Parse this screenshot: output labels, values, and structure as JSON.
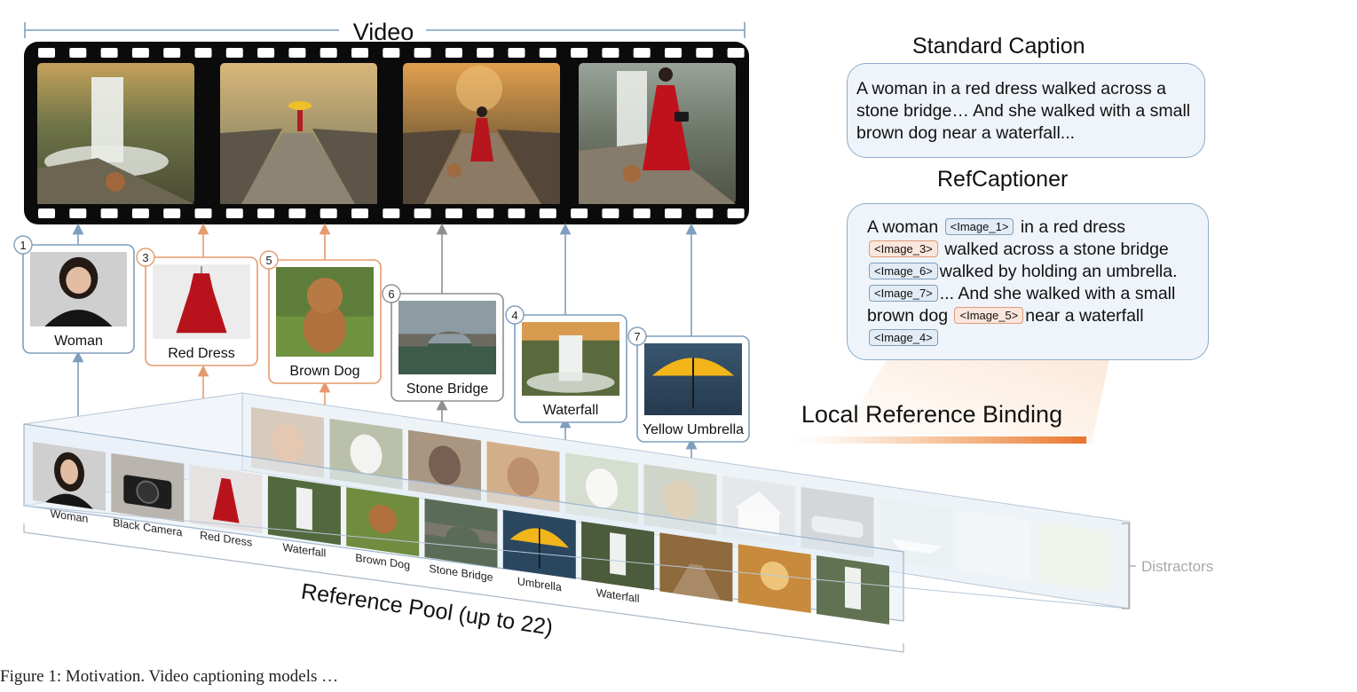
{
  "video": {
    "title": "Video",
    "frames": [
      "frame-waterfall-dog",
      "frame-umbrella-bridge",
      "frame-woman-dog-bridge",
      "frame-woman-camera-waterfall"
    ]
  },
  "references": [
    {
      "num": "1",
      "label": "Woman",
      "style": "blue",
      "icon": "woman-portrait"
    },
    {
      "num": "3",
      "label": "Red Dress",
      "style": "orange",
      "icon": "red-dress"
    },
    {
      "num": "5",
      "label": "Brown Dog",
      "style": "orange",
      "icon": "brown-dog"
    },
    {
      "num": "6",
      "label": "Stone Bridge",
      "style": "gray",
      "icon": "stone-bridge"
    },
    {
      "num": "4",
      "label": "Waterfall",
      "style": "blue",
      "icon": "waterfall"
    },
    {
      "num": "7",
      "label": "Yellow Umbrella",
      "style": "blue",
      "icon": "yellow-umbrella"
    }
  ],
  "standard_caption": {
    "title": "Standard Caption",
    "text": "A woman in a red dress walked across a stone bridge… And she walked with a small brown dog near a waterfall..."
  },
  "refcaptioner": {
    "title": "RefCaptioner",
    "segments": [
      {
        "t": "A woman "
      },
      {
        "tag": "<Image_1>",
        "c": "blue"
      },
      {
        "t": " in a red dress "
      },
      {
        "tag": "<Image_3>",
        "c": "orange"
      },
      {
        "t": " walked across a stone bridge "
      },
      {
        "tag": "<Image_6>",
        "c": "blue"
      },
      {
        "t": "walked by holding an umbrella."
      },
      {
        "tag": "<Image_7>",
        "c": "blue"
      },
      {
        "t": "...  And she walked with a small brown dog "
      },
      {
        "tag": "<Image_5>",
        "c": "orange"
      },
      {
        "t": "near a waterfall"
      },
      {
        "tag": "<Image_4>",
        "c": "blue"
      }
    ]
  },
  "binding_label": "Local Reference Binding",
  "pool": {
    "title": "Reference Pool (up to 22)",
    "front_items": [
      "Woman",
      "Black Camera",
      "Red Dress",
      "Waterfall",
      "Brown Dog",
      "Stone Bridge",
      "Umbrella",
      "Waterfall",
      "",
      "",
      ""
    ],
    "back_items": [
      "woman-smiling",
      "white-dog",
      "spaniel",
      "boxer",
      "white-cat",
      "pug",
      "house",
      "car",
      "boat",
      "mist",
      "field"
    ],
    "distractors_label": "Distractors"
  },
  "figure_caption": "Figure 1: Motivation. Video captioning models …",
  "colors": {
    "blue": "#7f9ebd",
    "orange": "#e59a6e",
    "gray": "#8f8f8f"
  }
}
